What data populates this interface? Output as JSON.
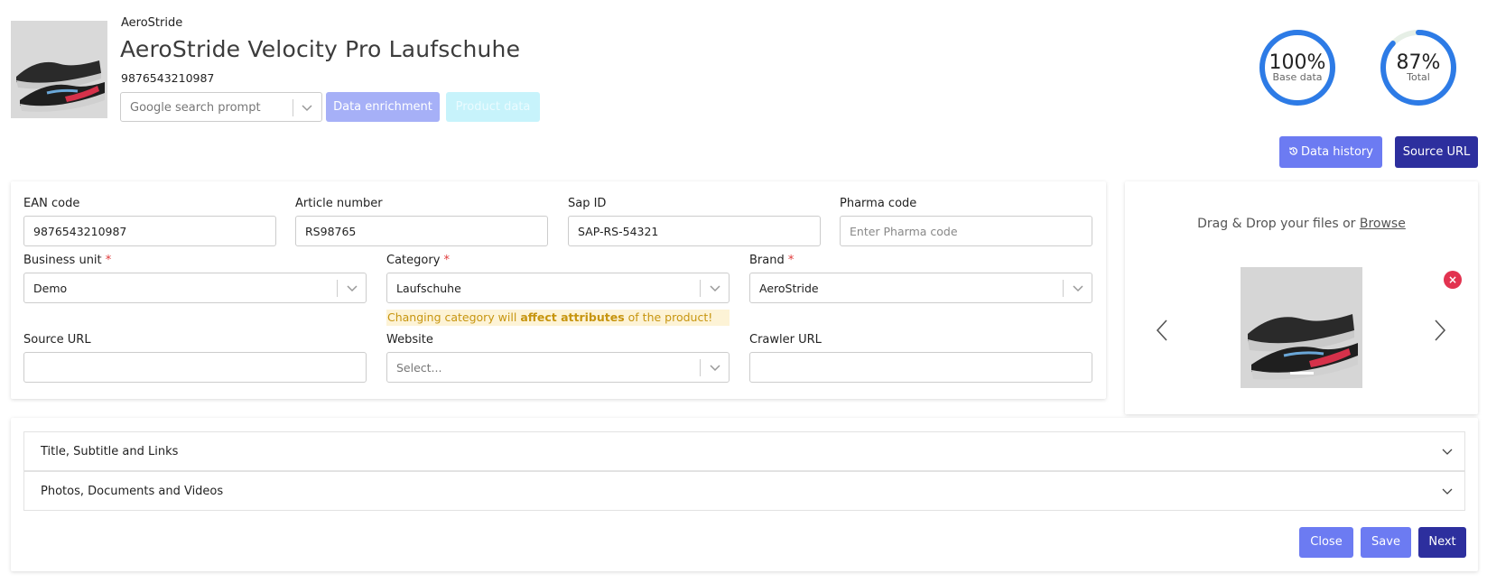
{
  "header": {
    "brand": "AeroStride",
    "title": "AeroStride Velocity Pro Laufschuhe",
    "ean": "9876543210987",
    "prompt_select": {
      "placeholder": "Google search prompt"
    },
    "data_enrichment_label": "Data enrichment",
    "product_data_label": "Product data",
    "gauges": [
      {
        "value": "100%",
        "label": "Base data",
        "fraction": 1.0,
        "color": "#2d7be6"
      },
      {
        "value": "87%",
        "label": "Total",
        "fraction": 0.87,
        "color": "#2d7be6"
      }
    ],
    "data_history_label": "Data history",
    "source_url_label": "Source URL"
  },
  "form": {
    "ean": {
      "label": "EAN code",
      "value": "9876543210987"
    },
    "article": {
      "label": "Article number",
      "value": "RS98765"
    },
    "sap": {
      "label": "Sap ID",
      "value": "SAP-RS-54321"
    },
    "pharma": {
      "label": "Pharma code",
      "placeholder": "Enter Pharma code"
    },
    "business_unit": {
      "label": "Business unit",
      "value": "Demo"
    },
    "category": {
      "label": "Category",
      "value": "Laufschuhe"
    },
    "brand": {
      "label": "Brand",
      "value": "AeroStride"
    },
    "category_warning": {
      "pre": "Changing category will ",
      "bold": "affect attributes",
      "post": " of the product!"
    },
    "source_url": {
      "label": "Source URL",
      "value": ""
    },
    "website": {
      "label": "Website",
      "placeholder": "Select..."
    },
    "crawler_url": {
      "label": "Crawler URL",
      "value": ""
    },
    "required_mark": "*"
  },
  "upload": {
    "text": "Drag & Drop your files or ",
    "browse": "Browse",
    "remove": "×"
  },
  "sections": [
    {
      "title": "Title, Subtitle and Links"
    },
    {
      "title": "Photos, Documents and Videos"
    }
  ],
  "footer": {
    "close_label": "Close",
    "save_label": "Save",
    "next_label": "Next"
  }
}
